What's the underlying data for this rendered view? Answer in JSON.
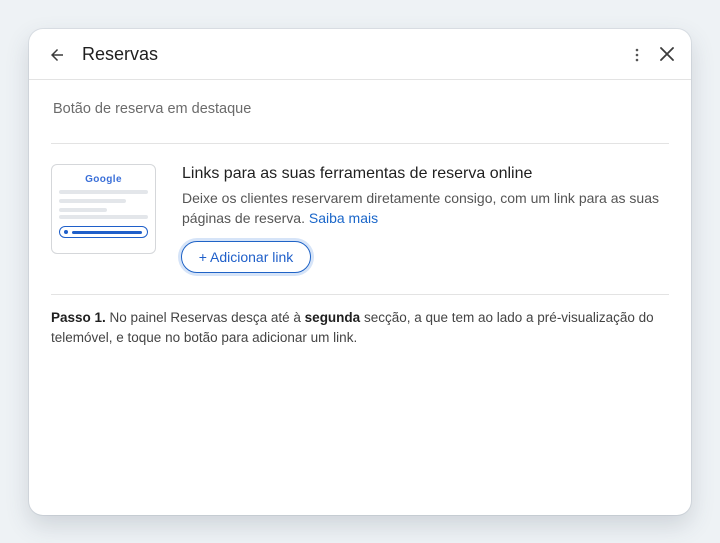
{
  "header": {
    "title": "Reservas",
    "icons": {
      "back": "arrow-back-icon",
      "more": "more-vert-icon",
      "close": "close-icon"
    }
  },
  "section": {
    "label": "Botão de reserva em destaque"
  },
  "thumbnail": {
    "brand": "Google"
  },
  "feature": {
    "title": "Links para as suas ferramentas de reserva online",
    "description": "Deixe os clientes reservarem diretamente consigo, com um link para as suas páginas de reserva.",
    "learn_more": "Saiba mais",
    "add_button": "+ Adicionar link"
  },
  "step": {
    "label": "Passo 1.",
    "text_before": " No painel Reservas desça até à ",
    "emphasis": "segunda",
    "text_after": " secção, a que tem ao lado a pré-visualização do telemóvel, e toque no botão para adicionar um link."
  },
  "colors": {
    "accent": "#1f5fc9",
    "link": "#1a66c9",
    "background": "#eef2f5",
    "divider": "#e3e3e3"
  }
}
